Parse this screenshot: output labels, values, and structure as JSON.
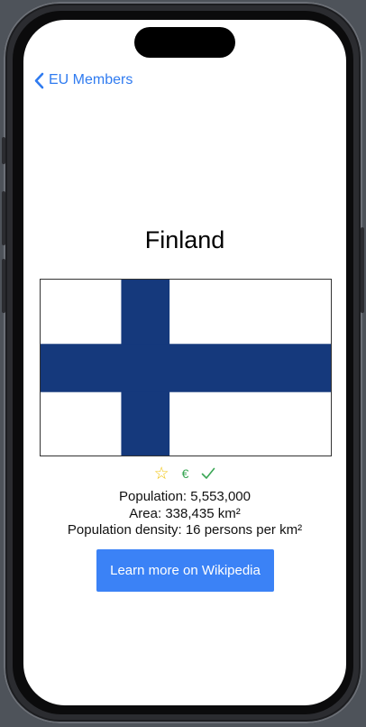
{
  "nav": {
    "back_label": "EU Members",
    "back_icon": "chevron-left-icon"
  },
  "country": {
    "name": "Finland",
    "flag": {
      "description_colors": {
        "field": "#ffffff",
        "cross": "#15397c"
      }
    }
  },
  "badges": {
    "favorite_icon": "star-outline-icon",
    "favorite_glyph": "☆",
    "currency_icon": "euro-icon",
    "currency_glyph": "€",
    "member_icon": "checkmark-icon"
  },
  "stats": {
    "population": "Population: 5,553,000",
    "area": "Area: 338,435 km²",
    "density": "Population density: 16 persons per km²"
  },
  "actions": {
    "wiki_label": "Learn more on Wikipedia"
  },
  "colors": {
    "accent": "#2f7bf0",
    "button": "#3b82f6",
    "star": "#f1c40f",
    "success": "#3aa655"
  }
}
